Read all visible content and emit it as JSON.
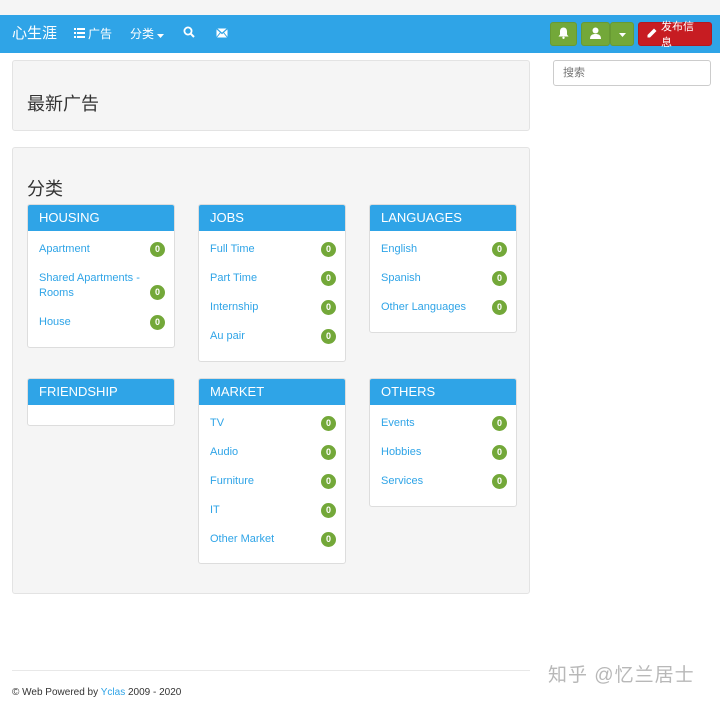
{
  "navbar": {
    "brand": "心生涯",
    "ads_label": "广告",
    "categories_label": "分类",
    "post_button_label": "发布信息"
  },
  "search": {
    "placeholder": "搜索"
  },
  "latest": {
    "title": "最新广告"
  },
  "categories": {
    "title": "分类",
    "panels": [
      {
        "title": "HOUSING",
        "items": [
          {
            "label": "Apartment",
            "count": "0"
          },
          {
            "label": "Shared Apartments - Rooms",
            "count": "0"
          },
          {
            "label": "House",
            "count": "0"
          }
        ]
      },
      {
        "title": "JOBS",
        "items": [
          {
            "label": "Full Time",
            "count": "0"
          },
          {
            "label": "Part Time",
            "count": "0"
          },
          {
            "label": "Internship",
            "count": "0"
          },
          {
            "label": "Au pair",
            "count": "0"
          }
        ]
      },
      {
        "title": "LANGUAGES",
        "items": [
          {
            "label": "English",
            "count": "0"
          },
          {
            "label": "Spanish",
            "count": "0"
          },
          {
            "label": "Other Languages",
            "count": "0"
          }
        ]
      },
      {
        "title": "FRIENDSHIP",
        "items": []
      },
      {
        "title": "MARKET",
        "items": [
          {
            "label": "TV",
            "count": "0"
          },
          {
            "label": "Audio",
            "count": "0"
          },
          {
            "label": "Furniture",
            "count": "0"
          },
          {
            "label": "IT",
            "count": "0"
          },
          {
            "label": "Other Market",
            "count": "0"
          }
        ]
      },
      {
        "title": "OTHERS",
        "items": [
          {
            "label": "Events",
            "count": "0"
          },
          {
            "label": "Hobbies",
            "count": "0"
          },
          {
            "label": "Services",
            "count": "0"
          }
        ]
      }
    ]
  },
  "footer": {
    "prefix": "© Web Powered by",
    "link": "Yclas",
    "years": "2009 - 2020"
  },
  "watermark": "知乎 @忆兰居士",
  "colors": {
    "primary": "#2fa4e7",
    "success": "#73a839",
    "danger": "#c71c22"
  },
  "icons": [
    "list-icon",
    "caret-down-icon",
    "search-icon",
    "envelope-icon",
    "bell-icon",
    "user-icon",
    "pencil-icon"
  ]
}
